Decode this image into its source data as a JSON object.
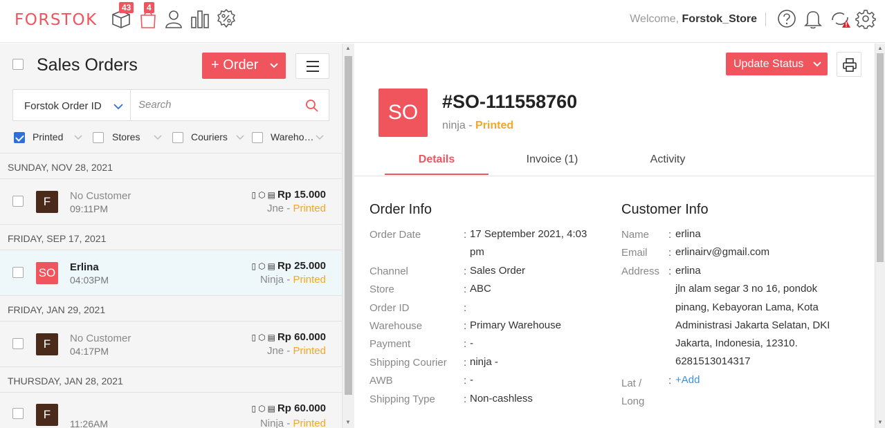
{
  "app": {
    "logo": "FORSTOK",
    "nav": {
      "products_badge": "43",
      "orders_badge": "4"
    },
    "welcome_prefix": "Welcome,",
    "store_name": "Forstok_Store"
  },
  "list": {
    "title": "Sales Orders",
    "order_button": "+ Order",
    "search_field": "Forstok Order ID",
    "search_placeholder": "Search",
    "filters": [
      {
        "label": "Printed",
        "checked": true
      },
      {
        "label": "Stores",
        "checked": false
      },
      {
        "label": "Couriers",
        "checked": false
      },
      {
        "label": "Wareho…",
        "checked": false
      }
    ],
    "groups": [
      {
        "date": "SUNDAY, NOV 28, 2021",
        "order": {
          "initial": "F",
          "customer": "No Customer",
          "time": "09:11PM",
          "amount": "Rp 15.000",
          "courier": "Jne",
          "status": "Printed",
          "color": "#4a2a1a"
        }
      },
      {
        "date": "FRIDAY, SEP 17, 2021",
        "order": {
          "initial": "SO",
          "customer": "Erlina",
          "time": "04:03PM",
          "amount": "Rp 25.000",
          "courier": "Ninja",
          "status": "Printed",
          "color": "#f0545c"
        }
      },
      {
        "date": "FRIDAY, JAN 29, 2021",
        "order": {
          "initial": "F",
          "customer": "No Customer",
          "time": "04:17PM",
          "amount": "Rp 60.000",
          "courier": "Jne",
          "status": "Printed",
          "color": "#4a2a1a"
        }
      },
      {
        "date": "THURSDAY, JAN 28, 2021",
        "order": {
          "initial": "F",
          "customer": "",
          "time": "11:26AM",
          "amount": "Rp 60.000",
          "courier": "Ninja",
          "status": "Printed",
          "color": "#4a2a1a"
        }
      }
    ]
  },
  "detail": {
    "update_status": "Update Status",
    "avatar": "SO",
    "order_number": "#SO-111558760",
    "courier": "ninja",
    "status": "Printed",
    "tabs": [
      "Details",
      "Invoice (1)",
      "Activity"
    ],
    "order_info": {
      "title": "Order Info",
      "order_date_label": "Order Date",
      "order_date_1": "17 September 2021, 4:03",
      "order_date_2": "pm",
      "channel_label": "Channel",
      "channel": "Sales Order",
      "store_label": "Store",
      "store": "ABC",
      "order_id_label": "Order ID",
      "order_id": "",
      "warehouse_label": "Warehouse",
      "warehouse": "Primary Warehouse",
      "payment_label": "Payment",
      "payment": "-",
      "shipping_courier_label": "Shipping Courier",
      "shipping_courier": "ninja -",
      "awb_label": "AWB",
      "awb": "-",
      "shipping_type_label": "Shipping Type",
      "shipping_type": "Non-cashless"
    },
    "customer_info": {
      "title": "Customer Info",
      "name_label": "Name",
      "name": "erlina",
      "email_label": "Email",
      "email": "erlinairv@gmail.com",
      "address_label": "Address",
      "address": [
        "erlina",
        "jln alam segar 3 no 16, pondok",
        "pinang, Kebayoran Lama, Kota",
        "Administrasi Jakarta Selatan, DKI",
        "Jakarta, Indonesia, 12310.",
        "6281513014317"
      ],
      "latlong_label_1": "Lat /",
      "latlong_label_2": "Long",
      "add_link": "+Add"
    }
  }
}
